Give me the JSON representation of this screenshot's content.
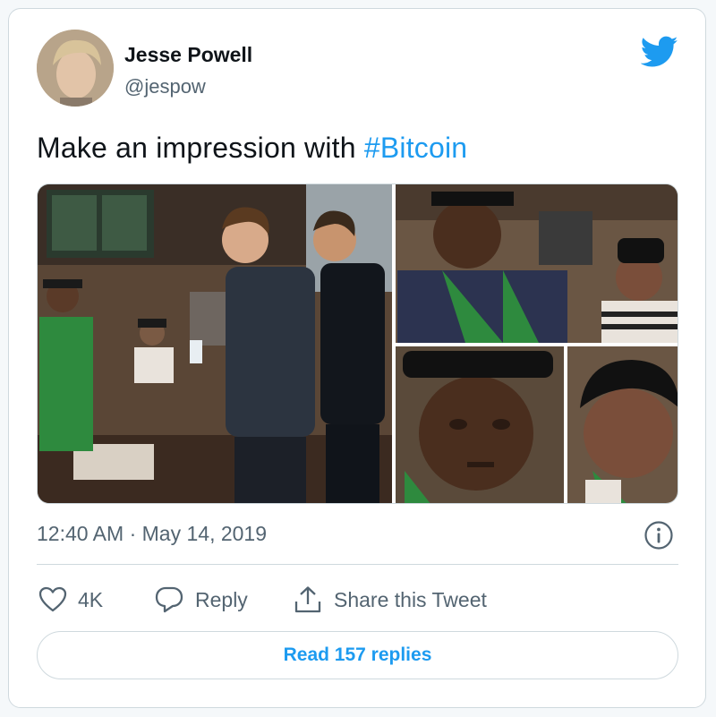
{
  "author": {
    "name": "Jesse Powell",
    "handle": "@jespow"
  },
  "tweet": {
    "text_prefix": "Make an impression with ",
    "hashtag": "#Bitcoin"
  },
  "media": {
    "images": [
      {
        "description": "Two men at a coffee shop counter paying with a phone"
      },
      {
        "description": "Barista in green apron and black cap"
      },
      {
        "description": "Barista in black cap behind counter"
      },
      {
        "description": "Close-up of barista face"
      },
      {
        "description": "Close-up of second barista face"
      }
    ]
  },
  "timestamp": {
    "time": "12:40 AM",
    "separator": " · ",
    "date": "May 14, 2019"
  },
  "actions": {
    "like_count": "4K",
    "reply_label": "Reply",
    "share_label": "Share this Tweet"
  },
  "read_replies_label": "Read 157 replies",
  "colors": {
    "accent": "#1d9bf0",
    "secondary_text": "#536471",
    "border": "#cfd9de"
  },
  "icons": [
    "twitter-bird-icon",
    "info-icon",
    "heart-icon",
    "reply-icon",
    "share-icon"
  ]
}
